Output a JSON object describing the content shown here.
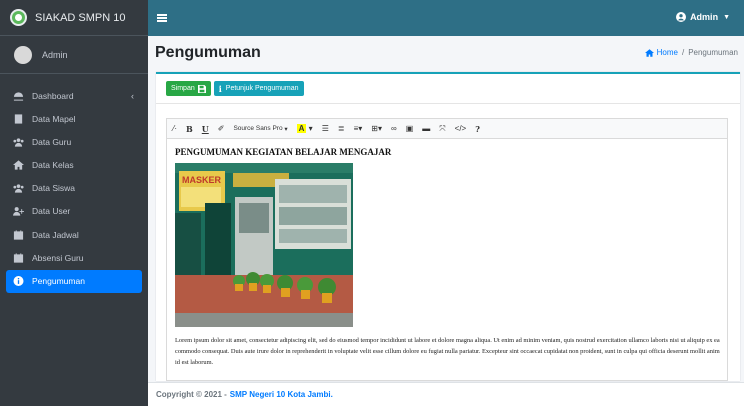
{
  "brand": {
    "name": "SIAKAD SMPN 10"
  },
  "user": {
    "name": "Admin"
  },
  "sidebar": {
    "items": [
      {
        "label": "Dashboard",
        "icon": "dashboard-icon",
        "active": false
      },
      {
        "label": "Data Mapel",
        "icon": "book-icon",
        "active": false
      },
      {
        "label": "Data Guru",
        "icon": "users-icon",
        "active": false
      },
      {
        "label": "Data Kelas",
        "icon": "home-icon",
        "active": false
      },
      {
        "label": "Data Siswa",
        "icon": "users-icon",
        "active": false
      },
      {
        "label": "Data User",
        "icon": "user-plus-icon",
        "active": false
      },
      {
        "label": "Data Jadwal",
        "icon": "calendar-icon",
        "active": false
      },
      {
        "label": "Absensi Guru",
        "icon": "calendar-check-icon",
        "active": false
      },
      {
        "label": "Pengumuman",
        "icon": "info-circle-icon",
        "active": true
      }
    ]
  },
  "topbar": {
    "admin_label": "Admin"
  },
  "header": {
    "title": "Pengumuman",
    "breadcrumb_home": "Home",
    "breadcrumb_separator": "/",
    "breadcrumb_current": "Pengumuman"
  },
  "toolbar": {
    "save_label": "Simpan",
    "guide_label": "Petunjuk Pengumuman"
  },
  "editor": {
    "font_name": "Source Sans Pro",
    "color_letter": "A",
    "heading": "PENGUMUMAN KEGIATAN BELAJAR MENGAJAR",
    "photo_sign_text": "MASKER",
    "body": "Lorem ipsum dolor sit amet, consectetur adipiscing elit, sed do eiusmod tempor incididunt ut labore et dolore magna aliqua. Ut enim ad minim veniam, quis nostrud exercitation ullamco laboris nisi ut aliquip ex ea commodo consequat. Duis aute irure dolor in reprehenderit in voluptate velit esse cillum dolore eu fugiat nulla pariatur. Excepteur sint occaecat cupidatat non proident, sunt in culpa qui officia deserunt mollit anim id est laborum."
  },
  "footer": {
    "copyright": "Copyright © 2021 -",
    "link": "SMP Negeri 10 Kota Jambi."
  },
  "colors": {
    "sidebar": "#343a40",
    "topbar": "#2e6f86",
    "active": "#007bff",
    "success": "#28a745",
    "info": "#17a2b8"
  }
}
